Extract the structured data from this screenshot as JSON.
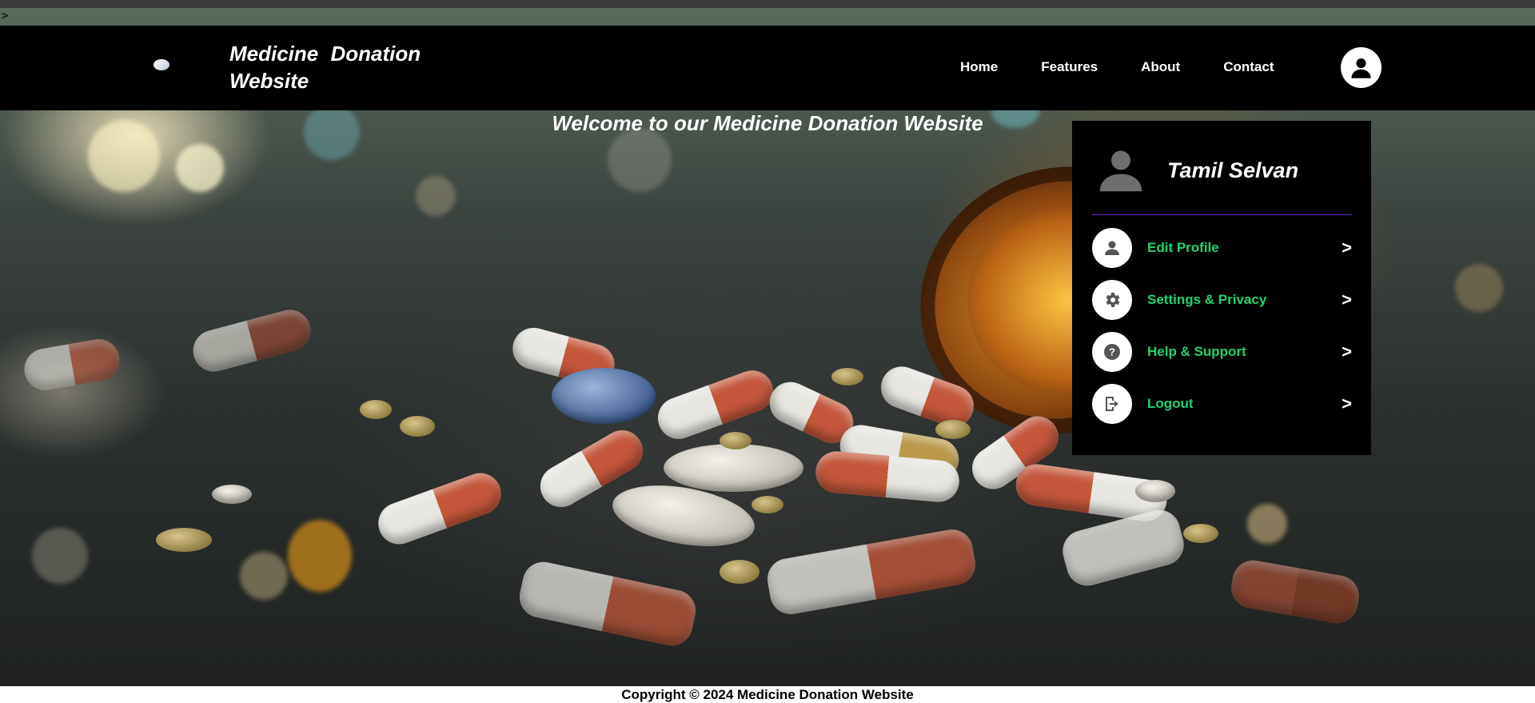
{
  "stray_text": ">",
  "header": {
    "brand": "Medicine Donation Website",
    "nav": [
      "Home",
      "Features",
      "About",
      "Contact"
    ]
  },
  "hero": {
    "welcome": "Welcome to our Medicine Donation Website"
  },
  "profile_menu": {
    "user_name": "Tamil Selvan",
    "items": [
      {
        "label": "Edit Profile",
        "icon": "person-icon",
        "arrow": ">"
      },
      {
        "label": "Settings & Privacy",
        "icon": "gear-icon",
        "arrow": ">"
      },
      {
        "label": "Help & Support",
        "icon": "question-icon",
        "arrow": ">"
      },
      {
        "label": "Logout",
        "icon": "logout-icon",
        "arrow": ">"
      }
    ],
    "label_color": "#23d36c",
    "divider_color": "#6a2bd0"
  },
  "footer": {
    "copyright": "Copyright © 2024 Medicine Donation Website"
  }
}
